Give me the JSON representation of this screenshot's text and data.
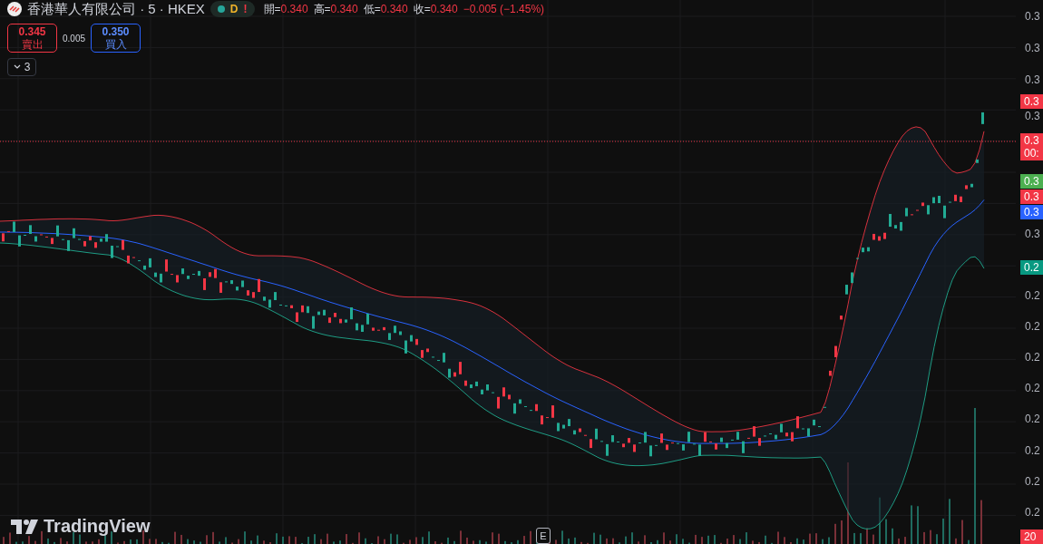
{
  "symbol": {
    "title": "香港華人有限公司 · 5 · HKEX",
    "status": "D",
    "alert": "!"
  },
  "ohlc": [
    {
      "label": "開=",
      "value": "0.340"
    },
    {
      "label": "高=",
      "value": "0.340"
    },
    {
      "label": "低=",
      "value": "0.340"
    },
    {
      "label": "收=",
      "value": "0.340"
    }
  ],
  "change": "−0.005 (−1.45%)",
  "sell": {
    "price": "0.345",
    "label": "賣出"
  },
  "spread": "0.005",
  "buy": {
    "price": "0.350",
    "label": "買入"
  },
  "indicators_count": "3",
  "price_axis": {
    "ticks": [
      "0.3",
      "0.3",
      "0.3",
      "0.3",
      "0.3",
      "0.2",
      "0.2",
      "0.2",
      "0.2",
      "0.2",
      "0.2",
      "0.2",
      "0.2"
    ],
    "badges": [
      {
        "text": "0.3",
        "color": "#f23645"
      },
      {
        "text": "0.3",
        "sub": "00:",
        "color": "#f23645"
      },
      {
        "text": "0.3",
        "color": "#4caf50"
      },
      {
        "text": "0.3",
        "color": "#f23645"
      },
      {
        "text": "0.3",
        "color": "#2962ff"
      },
      {
        "text": "0.2",
        "color": "#089981"
      },
      {
        "text": "20",
        "color": "#f23645"
      }
    ]
  },
  "event_marker": "E",
  "logo": "TradingView"
}
